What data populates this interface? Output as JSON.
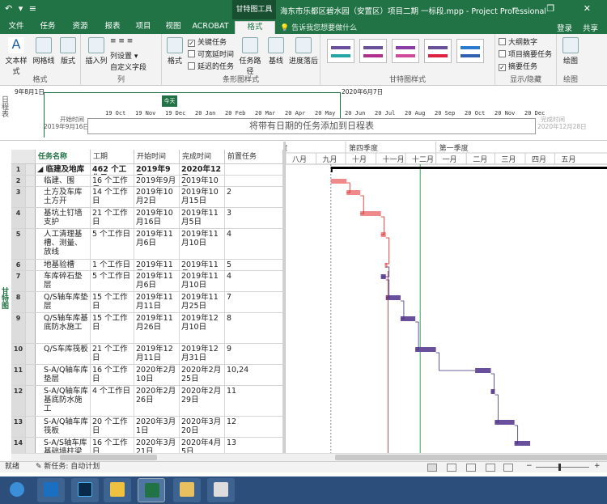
{
  "titlebar": {
    "context_tab": "甘特图工具",
    "title": "海东市乐都区碧水园（安置区）项目二期 一标段.mpp - Project Professional",
    "qat": "↶ ▾ ≡",
    "window_controls": "─ ❐ ✕"
  },
  "tabs": [
    {
      "label": "文件",
      "active": false
    },
    {
      "label": "任务",
      "active": false
    },
    {
      "label": "资源",
      "active": false
    },
    {
      "label": "报表",
      "active": false
    },
    {
      "label": "项目",
      "active": false
    },
    {
      "label": "视图",
      "active": false
    },
    {
      "label": "ACROBAT",
      "active": false
    },
    {
      "label": "格式",
      "active": true
    }
  ],
  "tell_me": "告诉我您想要做什么",
  "sign_in": "登录",
  "share": "共享",
  "ribbon": {
    "groups": [
      {
        "label": "格式"
      },
      {
        "label": "列"
      },
      {
        "label": "条形图样式"
      },
      {
        "label": "甘特图样式"
      },
      {
        "label": "显示/隐藏"
      },
      {
        "label": "绘图"
      }
    ],
    "format_buttons": [
      "文本样式",
      "网格线",
      "版式"
    ],
    "column_buttons": {
      "insert": "插入列",
      "col_settings": "列设置 ▾",
      "custom_fields": "自定义字段"
    },
    "bar_format": "格式",
    "bar_checks": [
      {
        "label": "关键任务",
        "checked": true
      },
      {
        "label": "可宽延时间",
        "checked": false
      },
      {
        "label": "延迟的任务",
        "checked": false
      }
    ],
    "bar_buttons": [
      "任务路径",
      "基线",
      "进度落后"
    ],
    "showhide_checks": [
      {
        "label": "大纲数字",
        "checked": false
      },
      {
        "label": "项目摘要任务",
        "checked": false
      },
      {
        "label": "摘要任务",
        "checked": true
      }
    ],
    "drawing": "绘图"
  },
  "timeline": {
    "side_label": "日程表",
    "start_date_top": "9年8月1日",
    "end_date_top": "2020年6月7日",
    "start_label": "开始时间",
    "start_date": "2019年9月16日",
    "end_label": "完成时间",
    "end_date": "2020年12月28日",
    "today": "今天",
    "placeholder": "将带有日期的任务添加到日程表",
    "scale": [
      "19 Oct",
      "19 Nov",
      "19 Dec",
      "20 Jan",
      "20 Feb",
      "20 Mar",
      "20 Apr",
      "20 May",
      "20 Jun",
      "20 Jul",
      "20 Aug",
      "20 Sep",
      "20 Oct",
      "20 Nov",
      "20 Dec"
    ]
  },
  "gantt_label": "甘特图",
  "table": {
    "columns": [
      "任务名称",
      "工期",
      "开始时间",
      "完成时间",
      "前置任务"
    ],
    "rows": [
      {
        "n": "1",
        "name": "◢ 临建及地库",
        "dur": "462 个工作日",
        "start": "2019年9月1",
        "finish": "2020年12月",
        "pred": "",
        "summary": true,
        "h": 14
      },
      {
        "n": "2",
        "name": "临建、围",
        "dur": "16 个工作日",
        "start": "2019年9月1",
        "finish": "2019年10月",
        "pred": "",
        "summary": false,
        "h": 14
      },
      {
        "n": "3",
        "name": "土方及车库土方开",
        "dur": "14 个工作日",
        "start": "2019年10月2日",
        "finish": "2019年10月15日",
        "pred": "2",
        "summary": false,
        "h": 26
      },
      {
        "n": "4",
        "name": "基坑土钉墙支护",
        "dur": "21 个工作日",
        "start": "2019年10月16日",
        "finish": "2019年11月5日",
        "pred": "3",
        "summary": false,
        "h": 26
      },
      {
        "n": "5",
        "name": "人工清理基槽、测量、放线",
        "dur": "5 个工作日",
        "start": "2019年11月6日",
        "finish": "2019年11月10日",
        "pred": "4",
        "summary": false,
        "h": 38
      },
      {
        "n": "6",
        "name": "地基验槽",
        "dur": "1 个工作日",
        "start": "2019年11月",
        "finish": "2019年11月",
        "pred": "5",
        "summary": false,
        "h": 14
      },
      {
        "n": "7",
        "name": "车库碎石垫层",
        "dur": "5 个工作日",
        "start": "2019年11月6日",
        "finish": "2019年11月10日",
        "pred": "4",
        "summary": false,
        "h": 26
      },
      {
        "n": "8",
        "name": "Q/S轴车库垫层",
        "dur": "15 个工作日",
        "start": "2019年11月11日",
        "finish": "2019年11月25日",
        "pred": "7",
        "summary": false,
        "h": 26
      },
      {
        "n": "9",
        "name": "Q/S轴车库基底防水施工",
        "dur": "15 个工作日",
        "start": "2019年11月26日",
        "finish": "2019年12月10日",
        "pred": "8",
        "summary": false,
        "h": 38
      },
      {
        "n": "10",
        "name": "Q/S车库筏板",
        "dur": "21 个工作日",
        "start": "2019年12月11日",
        "finish": "2019年12月31日",
        "pred": "9",
        "summary": false,
        "h": 26
      },
      {
        "n": "11",
        "name": "S-A/Q轴车库垫层",
        "dur": "16 个工作日",
        "start": "2020年2月10日",
        "finish": "2020年2月25日",
        "pred": "10,24",
        "summary": false,
        "h": 26
      },
      {
        "n": "12",
        "name": "S-A/Q轴车库基底防水施工",
        "dur": "4 个工作日",
        "start": "2020年2月26日",
        "finish": "2020年2月29日",
        "pred": "11",
        "summary": false,
        "h": 38
      },
      {
        "n": "13",
        "name": "S-A/Q轴车库筏板",
        "dur": "20 个工作日",
        "start": "2020年3月1日",
        "finish": "2020年3月20日",
        "pred": "12",
        "summary": false,
        "h": 26
      },
      {
        "n": "14",
        "name": "S-A/S轴车库基础墙柱梁板",
        "dur": "16 个工作日",
        "start": "2020年3月21日",
        "finish": "2020年4月5日",
        "pred": "13",
        "summary": false,
        "h": 30
      }
    ]
  },
  "gantt": {
    "quarters": [
      "第三季度",
      "第四季度",
      "第一季度"
    ],
    "months": [
      "八月",
      "九月",
      "十月",
      "十一月",
      "十二月",
      "一月",
      "二月",
      "三月",
      "四月",
      "五月"
    ],
    "critical_color": "#f08a8a",
    "normal_color": "#6a4f9c",
    "summary_color": "#000000"
  },
  "status": {
    "ready": "就绪",
    "new_task": "新任务: 自动计划"
  },
  "taskbar": {
    "apps": [
      "start-orb",
      "outlook",
      "photoshop",
      "notes",
      "project",
      "explorer",
      "remote"
    ]
  }
}
